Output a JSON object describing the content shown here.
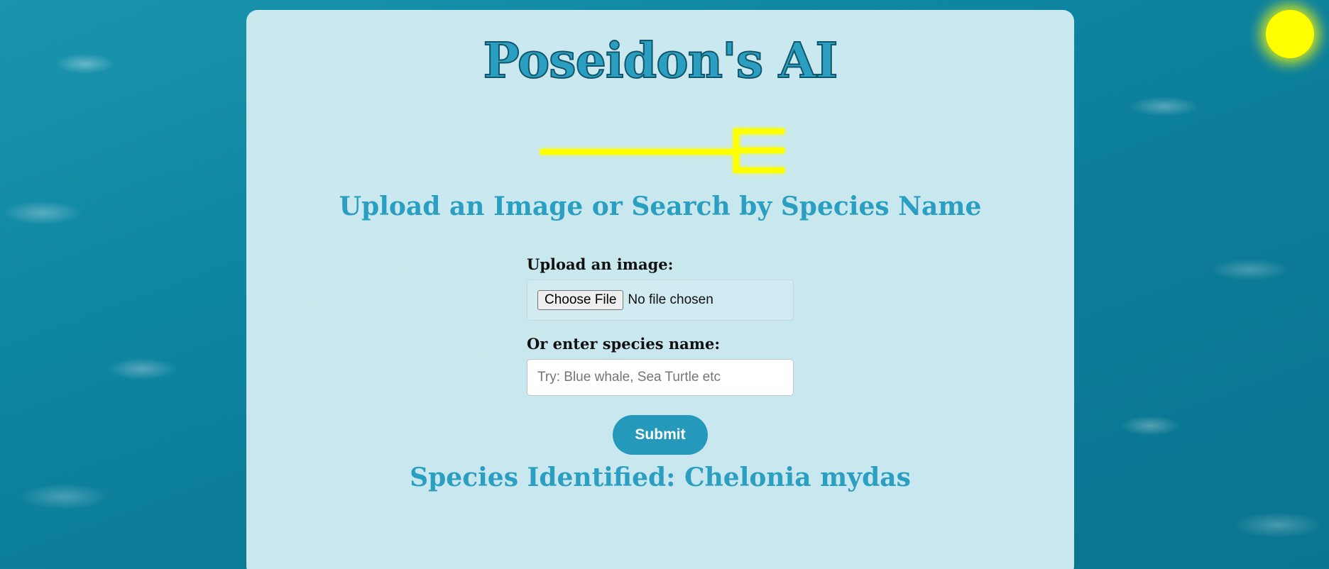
{
  "header": {
    "title": "Poseidon's AI"
  },
  "logo": {
    "icon": "trident-icon",
    "color": "#ffff00"
  },
  "decoration": {
    "sun_color": "#ffff00"
  },
  "main": {
    "subtitle": "Upload an Image or Search by Species Name",
    "upload": {
      "label": "Upload an image:",
      "button_label": "Choose File",
      "status": "No file chosen"
    },
    "species": {
      "label": "Or enter species name:",
      "value": "",
      "placeholder": "Try: Blue whale, Sea Turtle etc"
    },
    "submit_label": "Submit",
    "result": "Species Identified: Chelonia mydas"
  },
  "colors": {
    "accent": "#2a9fc1",
    "button": "#2599bc",
    "ocean": "#0f87a3",
    "card": "#d6eef3"
  }
}
